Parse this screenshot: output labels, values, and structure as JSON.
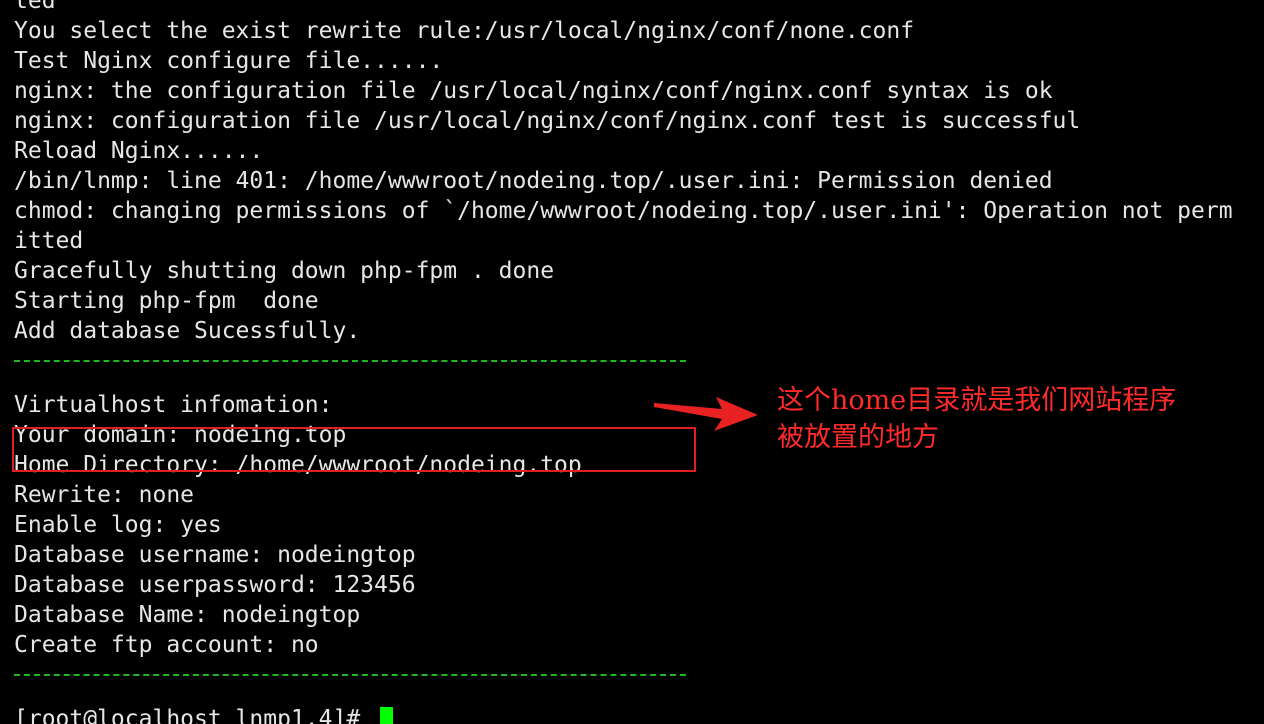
{
  "terminal": {
    "lines": [
      "ted",
      "You select the exist rewrite rule:/usr/local/nginx/conf/none.conf",
      "Test Nginx configure file......",
      "nginx: the configuration file /usr/local/nginx/conf/nginx.conf syntax is ok",
      "nginx: configuration file /usr/local/nginx/conf/nginx.conf test is successful",
      "Reload Nginx......",
      "/bin/lnmp: line 401: /home/wwwroot/nodeing.top/.user.ini: Permission denied",
      "chmod: changing permissions of `/home/wwwroot/nodeing.top/.user.ini': Operation not perm",
      "itted",
      "Gracefully shutting down php-fpm . done",
      "Starting php-fpm  done",
      "Add database Sucessfully."
    ],
    "info_lines": [
      "Virtualhost infomation:",
      "Your domain: nodeing.top",
      "Home Directory: /home/wwwroot/nodeing.top",
      "Rewrite: none",
      "Enable log: yes",
      "Database username: nodeingtop",
      "Database userpassword: 123456",
      "Database Name: nodeingtop",
      "Create ftp account: no"
    ],
    "prompt": "[root@localhost lnmp1.4]# "
  },
  "annotation": {
    "line1": "这个home目录就是我们网站程序",
    "line2": "被放置的地方",
    "color": "#ff2a2a"
  },
  "colors": {
    "background": "#000000",
    "text": "#e6e6e6",
    "separator": "#1fb81f",
    "cursor": "#00ff00",
    "highlight_box": "#e02020"
  }
}
